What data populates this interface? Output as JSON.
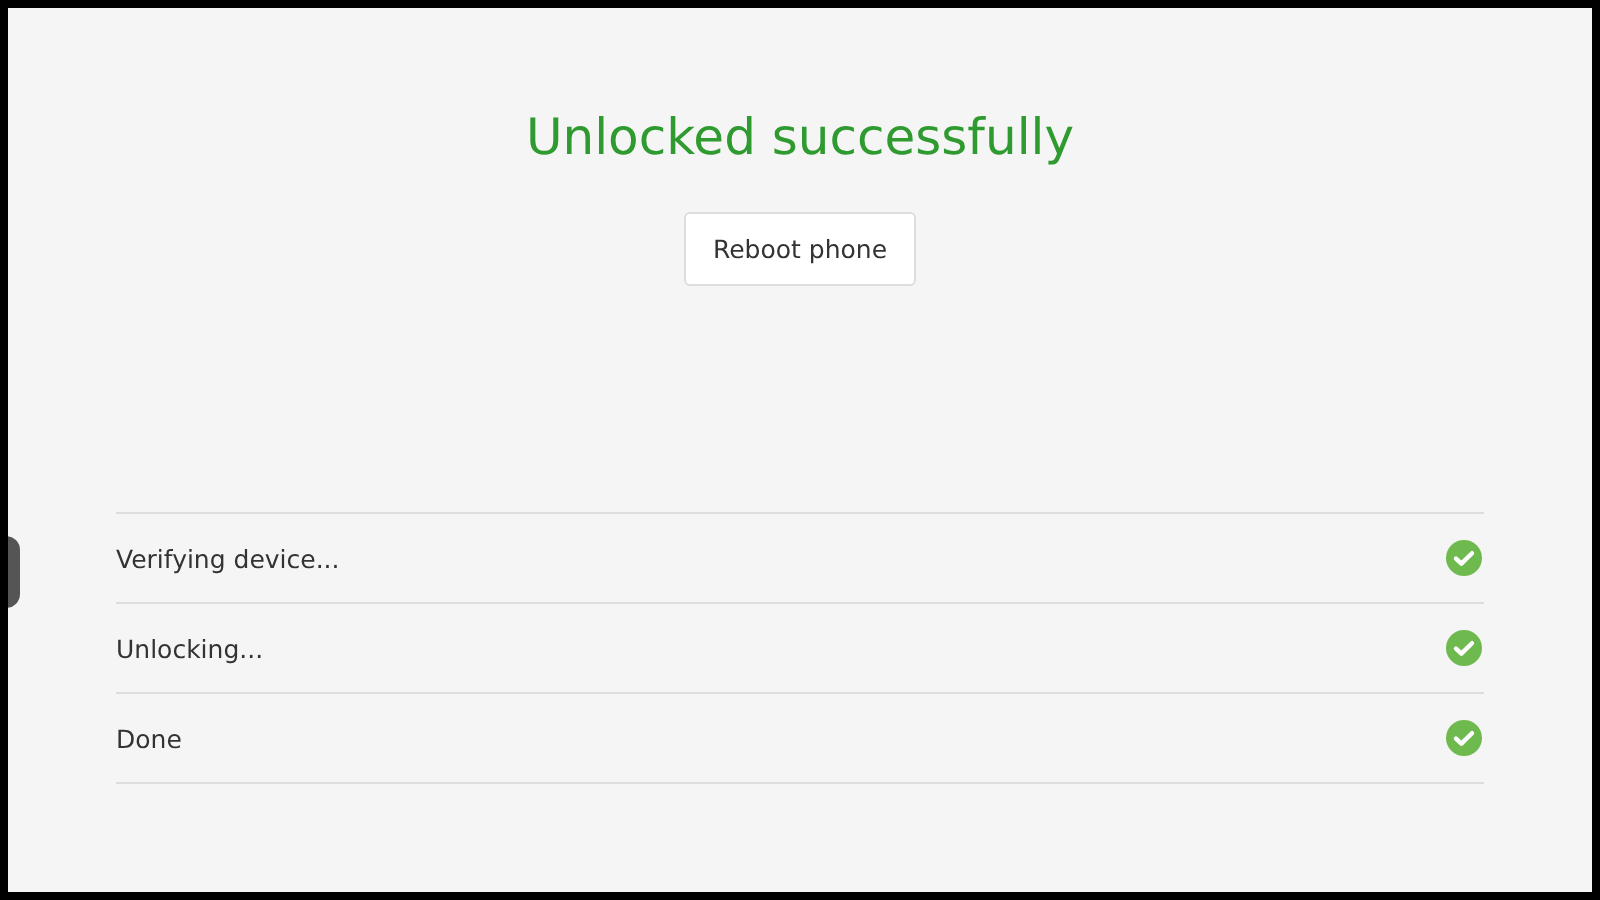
{
  "title": "Unlocked successfully",
  "button": {
    "label": "Reboot phone"
  },
  "steps": [
    {
      "label": "Verifying device...",
      "done": true
    },
    {
      "label": "Unlocking...",
      "done": true
    },
    {
      "label": "Done",
      "done": true
    }
  ]
}
